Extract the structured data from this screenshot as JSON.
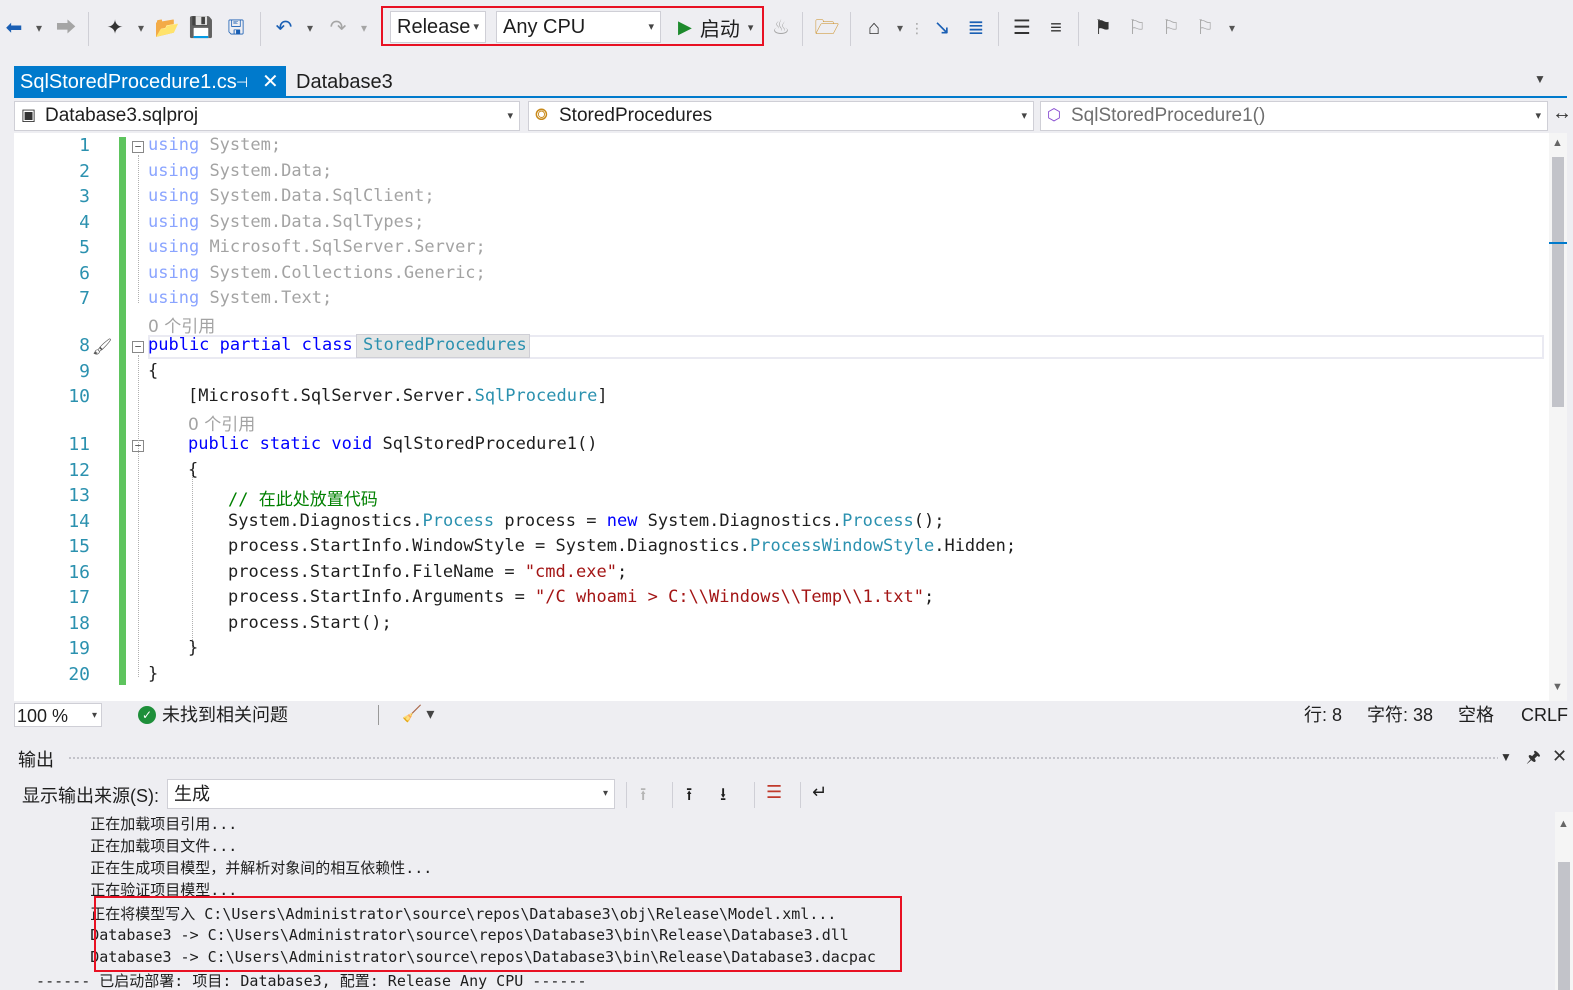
{
  "toolbar": {
    "configuration": "Release",
    "platform": "Any CPU",
    "start_label": "启动",
    "play_glyph": "▶",
    "dropdown_glyph": "▾"
  },
  "tabs": {
    "active": {
      "label": "SqlStoredProcedure1.cs",
      "pin": "⊣",
      "close": "✕"
    },
    "inactive": {
      "label": "Database3"
    }
  },
  "navbar": {
    "project": "Database3.sqlproj",
    "class": "StoredProcedures",
    "member": "SqlStoredProcedure1()"
  },
  "code": {
    "line_numbers": [
      "1",
      "2",
      "3",
      "4",
      "5",
      "6",
      "7",
      "8",
      "9",
      "10",
      "11",
      "12",
      "13",
      "14",
      "15",
      "16",
      "17",
      "18",
      "19",
      "20"
    ],
    "reference_hint": "0 个引用",
    "kw_using": "using",
    "using_targets": [
      "System;",
      "System.Data;",
      "System.Data.SqlClient;",
      "System.Data.SqlTypes;",
      "Microsoft.SqlServer.Server;",
      "System.Collections.Generic;",
      "System.Text;"
    ],
    "kw_public": "public",
    "kw_partial": "partial",
    "kw_class": "class",
    "class_name": "StoredProcedures",
    "kw_static": "static",
    "kw_void": "void",
    "kw_new": "new",
    "open_brace": "{",
    "close_brace": "}",
    "attribute_prefix": "[Microsoft.SqlServer.Server.",
    "attribute_name": "SqlProcedure",
    "attribute_suffix": "]",
    "method_name": "SqlStoredProcedure1",
    "method_parens": "()",
    "comment": "// 在此处放置代码",
    "l14_a": "System.Diagnostics.",
    "l14_type": "Process",
    "l14_b": " process = ",
    "l14_c": " System.Diagnostics.",
    "l14_type2": "Process",
    "l14_d": "();",
    "l15_a": "process.StartInfo.WindowStyle = System.Diagnostics.",
    "l15_type": "ProcessWindowStyle",
    "l15_b": ".Hidden;",
    "l16_a": "process.StartInfo.FileName = ",
    "l16_str": "\"cmd.exe\"",
    "l16_b": ";",
    "l17_a": "process.StartInfo.Arguments = ",
    "l17_str": "\"/C whoami > C:\\\\Windows\\\\Temp\\\\1.txt\"",
    "l17_b": ";",
    "l18": "process.Start();"
  },
  "status": {
    "zoom": "100 %",
    "issues": "未找到相关问题",
    "line": "行: 8",
    "char": "字符: 38",
    "whitespace": "空格",
    "line_ending": "CRLF"
  },
  "output": {
    "title": "输出",
    "source_label": "显示输出来源(S):",
    "source_value": "生成",
    "lines": [
      "        正在加载项目引用...",
      "        正在加载项目文件...",
      "        正在生成项目模型，并解析对象间的相互依赖性...",
      "        正在验证项目模型...",
      "        正在将模型写入 C:\\Users\\Administrator\\source\\repos\\Database3\\obj\\Release\\Model.xml...",
      "        Database3 -> C:\\Users\\Administrator\\source\\repos\\Database3\\bin\\Release\\Database3.dll",
      "        Database3 -> C:\\Users\\Administrator\\source\\repos\\Database3\\bin\\Release\\Database3.dacpac",
      "  ------ 已启动部署: 项目: Database3, 配置: Release Any CPU ------"
    ]
  },
  "colors": {
    "accent": "#007acc",
    "highlight_box": "#e81123",
    "change_bar": "#5ec45e",
    "keyword": "#0000ff",
    "type": "#2b91af",
    "string": "#a31515",
    "comment": "#008000"
  }
}
